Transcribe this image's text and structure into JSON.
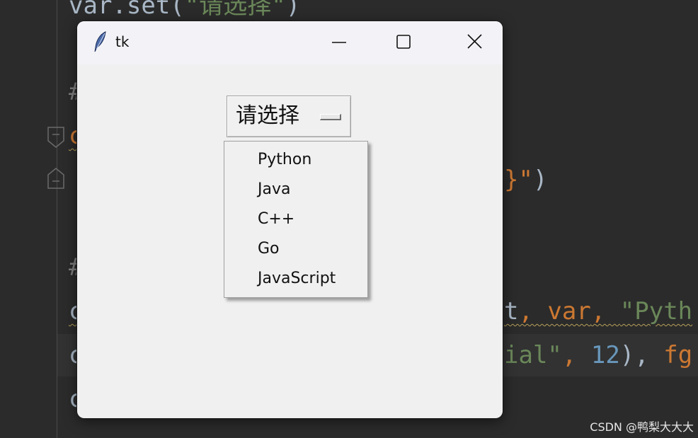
{
  "editor": {
    "lines": [
      {
        "a": "var.set(",
        "b": "\"请选择\"",
        "c": ")"
      },
      {
        "a": "#"
      },
      {
        "a": "c"
      },
      {
        "a": "}\"",
        "b": ")"
      },
      {
        "a": "#"
      },
      {
        "a": "c",
        "b": "t",
        "c": ", var",
        "d": ", ",
        "e": "\"Pyth"
      },
      {
        "a": "c",
        "b": "ial\"",
        "c": ", ",
        "d": "12",
        "e": "), ",
        "f": "fg"
      },
      {
        "a": "c"
      }
    ]
  },
  "watermark": "CSDN @鸭梨大大大",
  "window": {
    "title": "tk",
    "icon": "feather-icon"
  },
  "optionmenu": {
    "selected": "请选择",
    "options": [
      "Python",
      "Java",
      "C++",
      "Go",
      "JavaScript"
    ]
  },
  "colors": {
    "ide_background": "#2b2b2b",
    "window_background": "#f0f0f0",
    "titlebar": "#f3f3f7",
    "string": "#6a8759",
    "keyword": "#cc7832",
    "number": "#6897bb"
  }
}
